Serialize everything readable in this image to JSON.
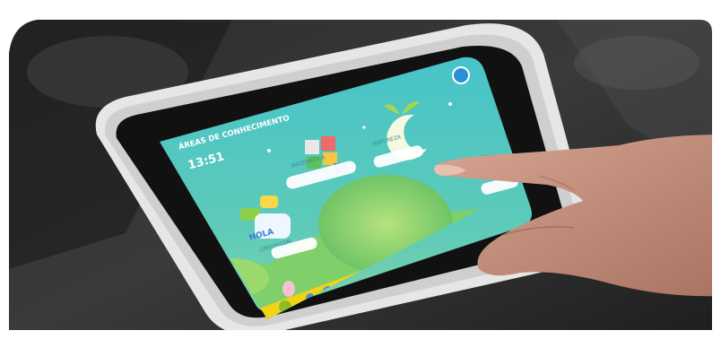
{
  "photo": {
    "screen": {
      "heading": "ÁREAS DE CONHECIMENTO",
      "clock": "13:51",
      "subject_labels": {
        "language": "LINGUAGEM",
        "math": "MATEMÁTICA",
        "nature": "NATUREZA",
        "social": "SOCIAL"
      },
      "greeting_word": "HOLA",
      "taskbar_icons": [
        "home-icon",
        "user-icon",
        "search-icon",
        "settings-icon",
        "camera-icon",
        "microphone-icon",
        "music-icon"
      ]
    },
    "colors": {
      "screen_top": "#47c3c9",
      "screen_bottom": "#7fd4a8",
      "taskbar": "#f2d316",
      "bezel": "#111111",
      "frame": "#e6e6e6",
      "hand": "#c4907c"
    }
  }
}
